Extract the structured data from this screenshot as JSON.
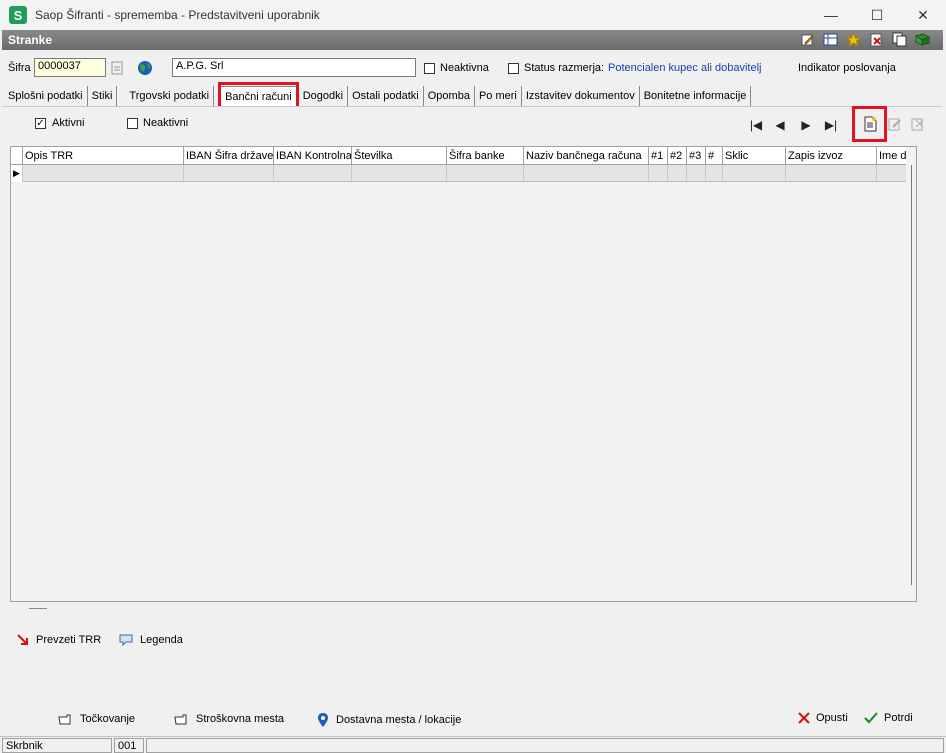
{
  "window": {
    "title": "Saop Šifranti - sprememba - Predstavitveni uporabnik",
    "minimize": "—",
    "maximize": "☐",
    "close": "✕"
  },
  "header": {
    "title": "Stranke",
    "icons": [
      "edit-icon",
      "table-icon",
      "star-icon",
      "delete-icon",
      "copy-icon",
      "book-icon"
    ]
  },
  "form": {
    "sifra_label": "Šifra",
    "sifra_value": "0000037",
    "name_value": "A.P.G. Srl",
    "neaktivna_label": "Neaktivna",
    "status_label": "Status razmerja:",
    "status_value": "Potencialen kupec ali dobavitelj",
    "indikator_label": "Indikator poslovanja"
  },
  "tabs": [
    "Splošni podatki",
    "Stiki",
    "Trgovski podatki",
    "Bančni računi",
    "Dogodki",
    "Ostali podatki",
    "Opomba",
    "Po meri",
    "Izstavitev dokumentov",
    "Bonitetne informacije"
  ],
  "filters": {
    "aktivni_label": "Aktivni",
    "aktivni_checked": "✓",
    "neaktivni_label": "Neaktivni"
  },
  "navigator": {
    "first": "|◀",
    "prev": "◀",
    "next": "▶",
    "last": "▶|"
  },
  "grid": {
    "columns": [
      "Opis TRR",
      "IBAN Šifra države",
      "IBAN Kontrolna",
      "Številka",
      "Šifra banke",
      "Naziv bančnega računa",
      "#1",
      "#2",
      "#3",
      "#",
      "Sklic",
      "Zapis izvoz",
      "Ime d"
    ],
    "row_indicator": "▶"
  },
  "actions": {
    "prevzeti_trr": "Prevzeti TRR",
    "legenda": "Legenda",
    "tockovanje": "Točkovanje",
    "stroskovna_mesta": "Stroškovna mesta",
    "dostavna_mesta": "Dostavna mesta / lokacije",
    "opusti": "Opusti",
    "potrdi": "Potrdi"
  },
  "statusbar": {
    "user": "Skrbnik",
    "code": "001"
  },
  "colors": {
    "highlight": "#e0141e",
    "link": "#1a3fb0",
    "header_bg": "#7a7a7a"
  }
}
